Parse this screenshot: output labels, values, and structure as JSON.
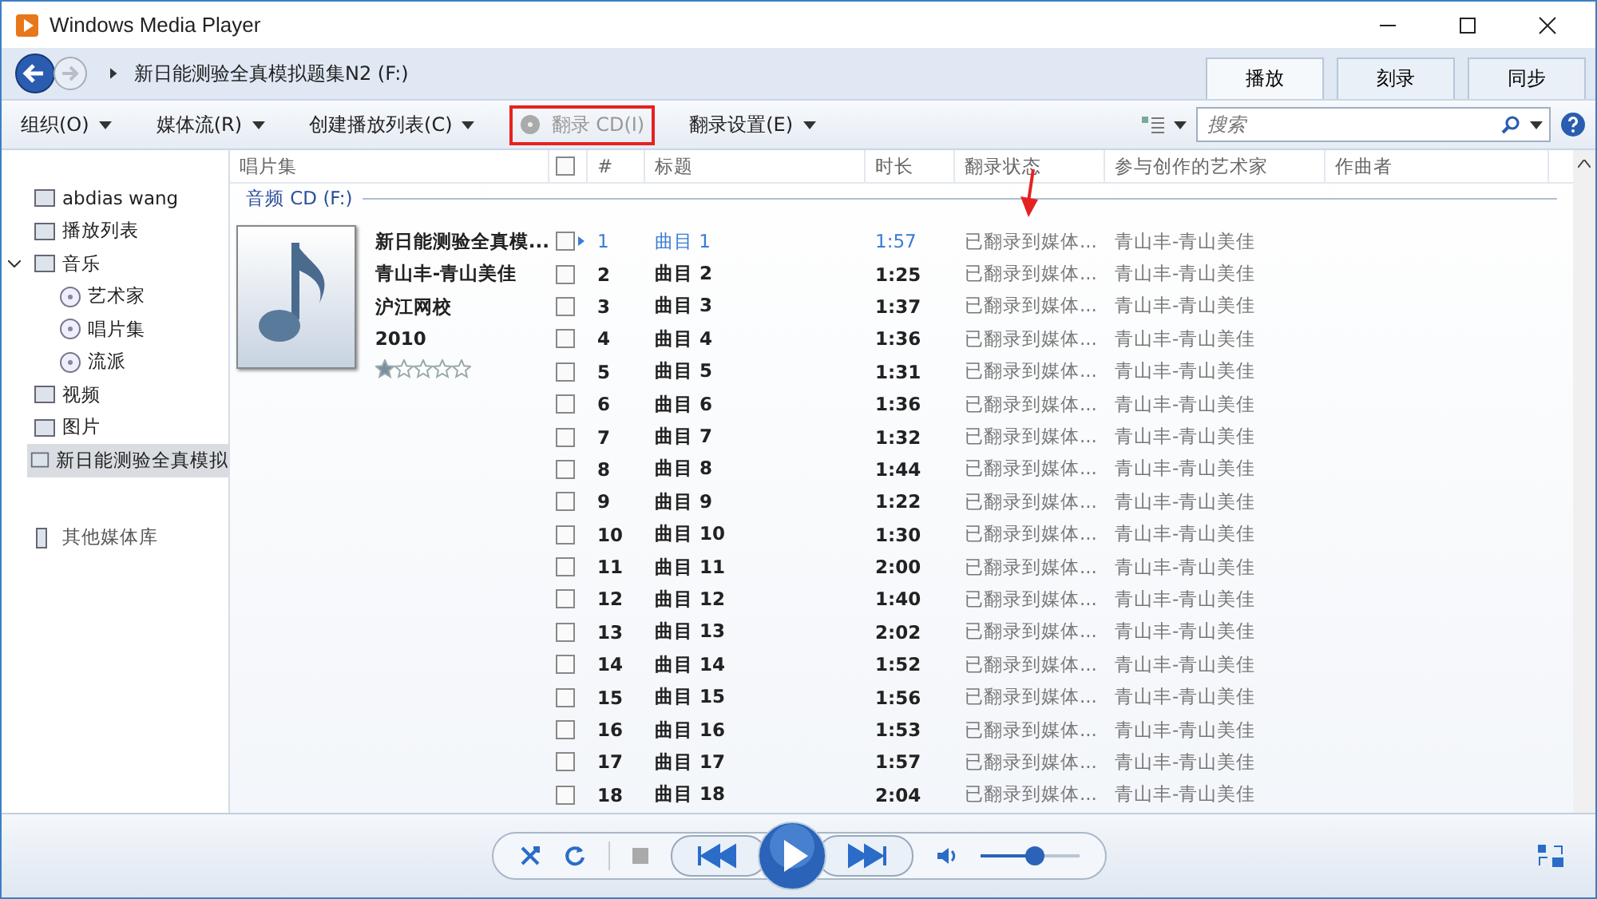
{
  "window": {
    "title": "Windows Media Player"
  },
  "nav": {
    "breadcrumb": "新日能测验全真模拟题集N2 (F:)"
  },
  "top_tabs": [
    {
      "label": "播放",
      "selected": true
    },
    {
      "label": "刻录",
      "selected": false
    },
    {
      "label": "同步",
      "selected": false
    }
  ],
  "toolbar": [
    {
      "label": "组织(O)",
      "disabled": false,
      "highlighted": false
    },
    {
      "label": "媒体流(R)",
      "disabled": false,
      "highlighted": false
    },
    {
      "label": "创建播放列表(C)",
      "disabled": false,
      "highlighted": false
    },
    {
      "label": "翻录 CD(I)",
      "disabled": true,
      "highlighted": true
    },
    {
      "label": "翻录设置(E)",
      "disabled": false,
      "highlighted": false
    }
  ],
  "search": {
    "placeholder": "搜索"
  },
  "sidebar": {
    "items": [
      {
        "label": "abdias wang",
        "selected": false
      },
      {
        "label": "播放列表",
        "selected": false
      },
      {
        "label": "音乐",
        "selected": false,
        "expanded": true,
        "children": [
          {
            "label": "艺术家",
            "selected": false
          },
          {
            "label": "唱片集",
            "selected": false
          },
          {
            "label": "流派",
            "selected": false
          }
        ]
      },
      {
        "label": "视频",
        "selected": false
      },
      {
        "label": "图片",
        "selected": false
      },
      {
        "label": "新日能测验全真模拟",
        "selected": true
      }
    ],
    "other": "其他媒体库"
  },
  "table": {
    "select_all": {
      "checked": false
    },
    "columns": [
      "唱片集",
      "#",
      "标题",
      "时长",
      "翻录状态",
      "参与创作的艺术家",
      "作曲者"
    ],
    "group": "音频 CD (F:)",
    "album": {
      "title": "新日能测验全真模...",
      "artist": "青山丰-青山美佳",
      "publisher": "沪江网校",
      "year": "2010",
      "stars": 1
    },
    "rows": [
      {
        "n": "1",
        "title": "曲目 1",
        "duration": "1:57",
        "status": "已翻录到媒体...",
        "artist": "青山丰-青山美佳",
        "checked": false,
        "selected": true
      },
      {
        "n": "2",
        "title": "曲目 2",
        "duration": "1:25",
        "status": "已翻录到媒体...",
        "artist": "青山丰-青山美佳",
        "checked": false,
        "selected": false
      },
      {
        "n": "3",
        "title": "曲目 3",
        "duration": "1:37",
        "status": "已翻录到媒体...",
        "artist": "青山丰-青山美佳",
        "checked": false,
        "selected": false
      },
      {
        "n": "4",
        "title": "曲目 4",
        "duration": "1:36",
        "status": "已翻录到媒体...",
        "artist": "青山丰-青山美佳",
        "checked": false,
        "selected": false
      },
      {
        "n": "5",
        "title": "曲目 5",
        "duration": "1:31",
        "status": "已翻录到媒体...",
        "artist": "青山丰-青山美佳",
        "checked": false,
        "selected": false
      },
      {
        "n": "6",
        "title": "曲目 6",
        "duration": "1:36",
        "status": "已翻录到媒体...",
        "artist": "青山丰-青山美佳",
        "checked": false,
        "selected": false
      },
      {
        "n": "7",
        "title": "曲目 7",
        "duration": "1:32",
        "status": "已翻录到媒体...",
        "artist": "青山丰-青山美佳",
        "checked": false,
        "selected": false
      },
      {
        "n": "8",
        "title": "曲目 8",
        "duration": "1:44",
        "status": "已翻录到媒体...",
        "artist": "青山丰-青山美佳",
        "checked": false,
        "selected": false
      },
      {
        "n": "9",
        "title": "曲目 9",
        "duration": "1:22",
        "status": "已翻录到媒体...",
        "artist": "青山丰-青山美佳",
        "checked": false,
        "selected": false
      },
      {
        "n": "10",
        "title": "曲目 10",
        "duration": "1:30",
        "status": "已翻录到媒体...",
        "artist": "青山丰-青山美佳",
        "checked": false,
        "selected": false
      },
      {
        "n": "11",
        "title": "曲目 11",
        "duration": "2:00",
        "status": "已翻录到媒体...",
        "artist": "青山丰-青山美佳",
        "checked": false,
        "selected": false
      },
      {
        "n": "12",
        "title": "曲目 12",
        "duration": "1:40",
        "status": "已翻录到媒体...",
        "artist": "青山丰-青山美佳",
        "checked": false,
        "selected": false
      },
      {
        "n": "13",
        "title": "曲目 13",
        "duration": "2:02",
        "status": "已翻录到媒体...",
        "artist": "青山丰-青山美佳",
        "checked": false,
        "selected": false
      },
      {
        "n": "14",
        "title": "曲目 14",
        "duration": "1:52",
        "status": "已翻录到媒体...",
        "artist": "青山丰-青山美佳",
        "checked": false,
        "selected": false
      },
      {
        "n": "15",
        "title": "曲目 15",
        "duration": "1:56",
        "status": "已翻录到媒体...",
        "artist": "青山丰-青山美佳",
        "checked": false,
        "selected": false
      },
      {
        "n": "16",
        "title": "曲目 16",
        "duration": "1:53",
        "status": "已翻录到媒体...",
        "artist": "青山丰-青山美佳",
        "checked": false,
        "selected": false
      },
      {
        "n": "17",
        "title": "曲目 17",
        "duration": "1:57",
        "status": "已翻录到媒体...",
        "artist": "青山丰-青山美佳",
        "checked": false,
        "selected": false
      },
      {
        "n": "18",
        "title": "曲目 18",
        "duration": "2:04",
        "status": "已翻录到媒体...",
        "artist": "青山丰-青山美佳",
        "checked": false,
        "selected": false
      }
    ]
  },
  "player": {
    "volume": {
      "level": 0.55
    }
  }
}
